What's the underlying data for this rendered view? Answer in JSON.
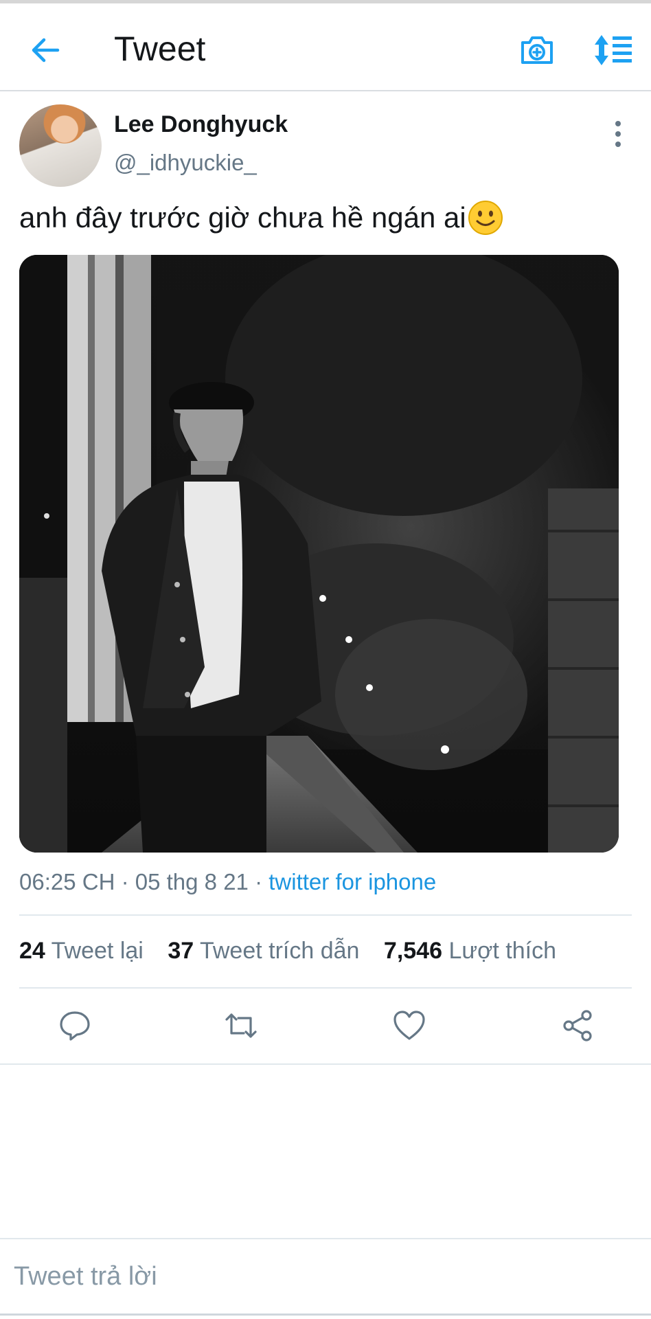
{
  "header": {
    "title": "Tweet",
    "back_icon": "arrow-left-icon",
    "camera_icon": "camera-add-icon",
    "sort_icon": "sort-icon",
    "accent": "#1da1f2"
  },
  "tweet": {
    "author_name": "Lee Donghyuck",
    "author_handle": "@_idhyuckie_",
    "text": "anh đây trước giờ chưa hề ngán ai",
    "emoji": "slightly-smiling-face",
    "time": "06:25 CH",
    "date": "05 thg 8 21",
    "source": "twitter for iphone",
    "source_color": "#1b95e0"
  },
  "stats": {
    "retweets_count": "24",
    "retweets_label": "Tweet lại",
    "quotes_count": "37",
    "quotes_label": "Tweet trích dẫn",
    "likes_count": "7,546",
    "likes_label": "Lượt thích"
  },
  "actions": [
    "reply-icon",
    "retweet-icon",
    "like-icon",
    "share-icon"
  ],
  "reply": {
    "placeholder": "Tweet trả lời"
  }
}
